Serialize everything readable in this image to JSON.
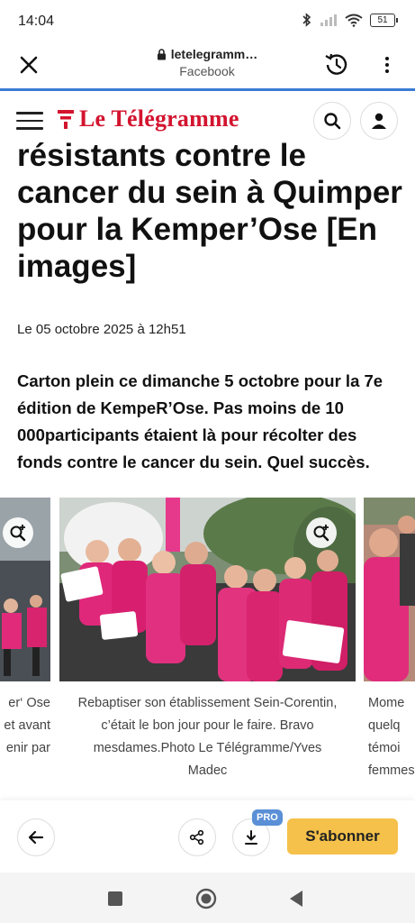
{
  "status_bar": {
    "time": "14:04",
    "battery": "51",
    "icons": [
      "bluetooth-icon",
      "signal-icon",
      "wifi-icon",
      "battery-icon"
    ]
  },
  "browser": {
    "url": "letelegramm…",
    "subtitle": "Facebook",
    "accent_color": "#3a7bd5"
  },
  "site_header": {
    "brand": "Le Télégramme",
    "brand_color": "#d3142f"
  },
  "article": {
    "headline_lines": [
      "résistants contre le",
      "cancer du sein à Quimper",
      "pour la Kemper’Ose [En",
      "images]"
    ],
    "date": "Le 05 octobre 2025 à 12h51",
    "lede": "Carton plein ce dimanche 5 octobre pour la 7e édition de KempeR’Ose. Pas moins de 10 000participants étaient là pour récolter des fonds contre le cancer du sein. Quel succès."
  },
  "gallery": {
    "left": {
      "caption_lines": [
        "er‘ Ose",
        "et avant",
        "enir par"
      ]
    },
    "center": {
      "caption_lines": [
        "Rebaptiser son établissement Sein-Corentin,",
        "c’était le bon jour pour le faire. Bravo",
        "mesdames.Photo Le Télégramme/Yves",
        "Madec"
      ]
    },
    "right": {
      "caption_lines": [
        "Mome",
        "quelq",
        "témoi",
        "femmes"
      ]
    }
  },
  "bottom_bar": {
    "pro_badge": "PRO",
    "subscribe_label": "S'abonner",
    "subscribe_color": "#f5c14a"
  }
}
